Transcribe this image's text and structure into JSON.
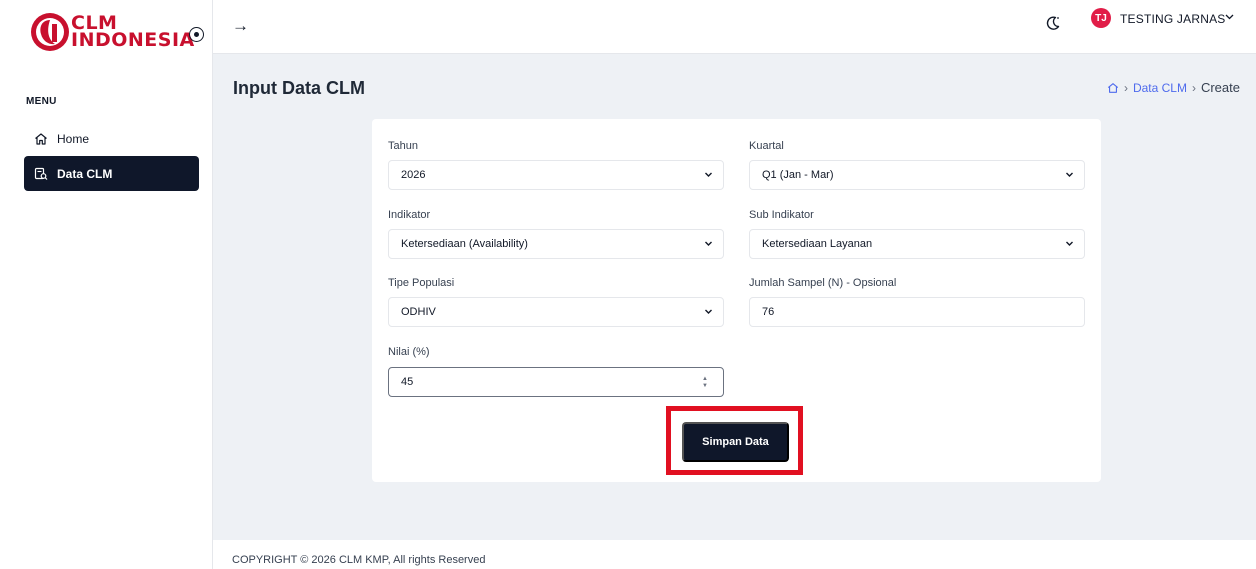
{
  "sidebar": {
    "logo_line1": "CLM",
    "logo_line2": "INDONESIA",
    "menu_label": "MENU",
    "items": [
      {
        "label": "Home",
        "icon": "home-icon"
      },
      {
        "label": "Data CLM",
        "icon": "document-search-icon",
        "active": true
      }
    ]
  },
  "topbar": {
    "user_initials": "TJ",
    "user_name": "TESTING JARNAS",
    "avatar_color": "#e11d48"
  },
  "page": {
    "title": "Input Data CLM",
    "breadcrumb": {
      "home_icon": "home-icon",
      "link": "Data CLM",
      "current": "Create"
    }
  },
  "form": {
    "tahun_label": "Tahun",
    "tahun_value": "2026",
    "kuartal_label": "Kuartal",
    "kuartal_value": "Q1 (Jan - Mar)",
    "indikator_label": "Indikator",
    "indikator_value": "Ketersediaan (Availability)",
    "sub_indikator_label": "Sub Indikator",
    "sub_indikator_value": "Ketersediaan Layanan",
    "tipe_populasi_label": "Tipe Populasi",
    "tipe_populasi_value": "ODHIV",
    "jumlah_sampel_label": "Jumlah Sampel (N) - Opsional",
    "jumlah_sampel_value": "76",
    "nilai_label": "Nilai (%)",
    "nilai_value": "45",
    "submit_label": "Simpan Data"
  },
  "footer": {
    "text": "COPYRIGHT © 2026 CLM KMP, All rights Reserved"
  },
  "colors": {
    "primary_dark": "#0f172a",
    "highlight_red": "#e11021",
    "brand_red": "#c8102e",
    "link_blue": "#4f6bed"
  }
}
